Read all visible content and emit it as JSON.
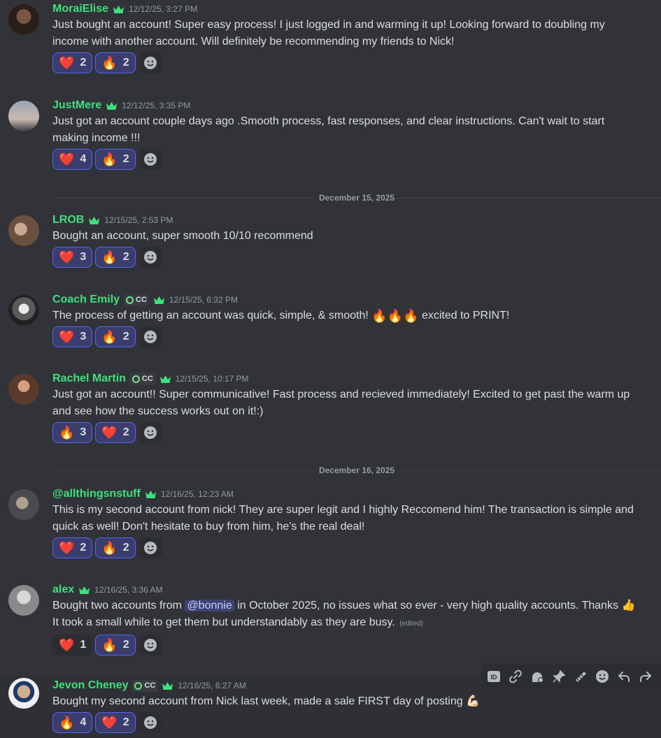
{
  "messages": [
    {
      "username": "MoraiElise",
      "timestamp": "12/12/25, 3:27 PM",
      "tag": null,
      "lines": [
        "Just bought an account! Super easy process! I just logged in and warming it up! Looking forward to doubling my",
        "income with another account. Will definitely be recommending my friends to Nick!"
      ],
      "reactions": [
        {
          "emoji": "❤️",
          "count": "2",
          "me": true
        },
        {
          "emoji": "🔥",
          "count": "2",
          "me": true
        }
      ]
    },
    {
      "username": "JustMere",
      "timestamp": "12/12/25, 3:35 PM",
      "tag": null,
      "lines": [
        "Just got an account couple days ago .Smooth process, fast responses, and clear instructions. Can't wait to start",
        "making income !!!"
      ],
      "reactions": [
        {
          "emoji": "❤️",
          "count": "4",
          "me": true
        },
        {
          "emoji": "🔥",
          "count": "2",
          "me": true
        }
      ]
    },
    {
      "username": "LROB",
      "timestamp": "12/15/25, 2:53 PM",
      "tag": null,
      "lines": [
        "Bought an account, super smooth 10/10 recommend"
      ],
      "reactions": [
        {
          "emoji": "❤️",
          "count": "3",
          "me": true
        },
        {
          "emoji": "🔥",
          "count": "2",
          "me": true
        }
      ]
    },
    {
      "username": "Coach Emily",
      "timestamp": "12/15/25, 6:32 PM",
      "tag": "CC",
      "text_before": "The process of getting an account was quick, simple, & smooth!",
      "inline_emoji": "🔥🔥🔥",
      "text_after": "excited to PRINT!",
      "reactions": [
        {
          "emoji": "❤️",
          "count": "3",
          "me": true
        },
        {
          "emoji": "🔥",
          "count": "2",
          "me": true
        }
      ]
    },
    {
      "username": "Rachel Martin",
      "timestamp": "12/15/25, 10:17 PM",
      "tag": "CC",
      "lines": [
        "Just got an account!! Super communicative! Fast process and recieved immediately! Excited to get past the warm up",
        "and see how the success works out on it!:)"
      ],
      "reactions": [
        {
          "emoji": "🔥",
          "count": "3",
          "me": true
        },
        {
          "emoji": "❤️",
          "count": "2",
          "me": true
        }
      ]
    },
    {
      "username": "@allthingsnstuff",
      "timestamp": "12/16/25, 12:23 AM",
      "tag": null,
      "lines": [
        "This is my second account from nick! They are super legit and I highly Reccomend him! The transaction is simple and",
        "quick as well! Don't hesitate to buy from him, he's the real deal!"
      ],
      "reactions": [
        {
          "emoji": "❤️",
          "count": "2",
          "me": true
        },
        {
          "emoji": "🔥",
          "count": "2",
          "me": true
        }
      ]
    },
    {
      "username": "alex",
      "timestamp": "12/16/25, 3:36 AM",
      "tag": null,
      "line1_before": "Bought two accounts from",
      "mention": "@bonnie",
      "line1_after": "in October 2025, no issues what so ever - very high quality accounts. Thanks 👍",
      "line2": "It took a small while to get them but understandably as they are busy.",
      "edited": "(edited)",
      "reactions": [
        {
          "emoji": "❤️",
          "count": "1",
          "me": false
        },
        {
          "emoji": "🔥",
          "count": "2",
          "me": true
        }
      ]
    },
    {
      "username": "Jevon Cheney",
      "timestamp": "12/16/25, 6:27 AM",
      "tag": "CC",
      "lines": [
        "Bought my second account from Nick last week, made a sale FIRST day of posting 💪🏻"
      ],
      "reactions": [
        {
          "emoji": "🔥",
          "count": "4",
          "me": true
        },
        {
          "emoji": "❤️",
          "count": "2",
          "me": true
        }
      ]
    }
  ],
  "dividers": [
    "December 15, 2025",
    "December 16, 2025"
  ],
  "toolbar_icons": [
    "app-id-icon",
    "link-icon",
    "thread-icon",
    "pin-icon",
    "mark-unread-icon",
    "add-reaction-icon",
    "reply-icon",
    "forward-icon"
  ]
}
